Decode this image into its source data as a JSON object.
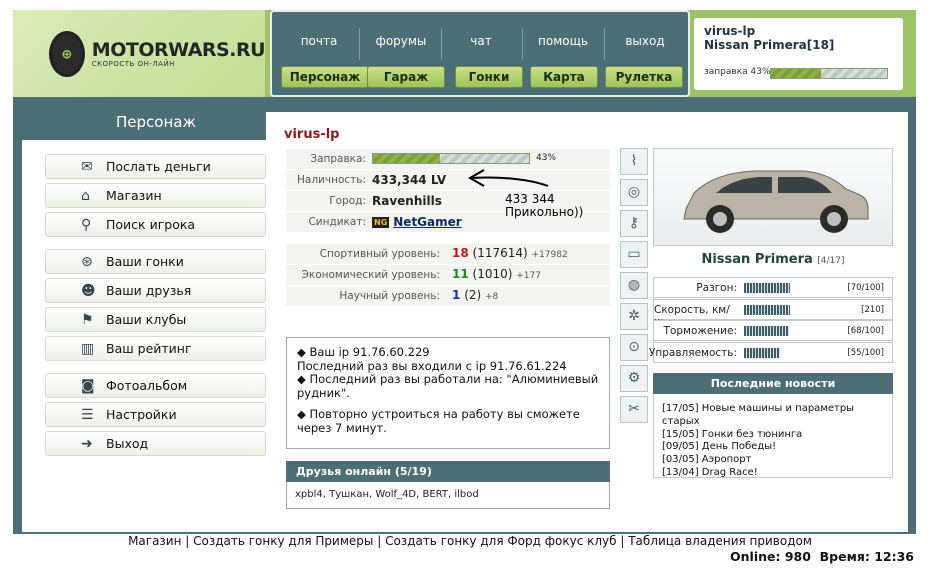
{
  "brand": {
    "name": "MOTORWARS.RU",
    "slogan": "СКОРОСТЬ ОН-ЛАЙН"
  },
  "topnav": {
    "links": [
      "почта",
      "форумы",
      "чат",
      "помощь",
      "выход"
    ],
    "buttons": [
      "Персонаж",
      "Гараж",
      "Гонки",
      "Карта",
      "Рулетка"
    ]
  },
  "user": {
    "name": "virus-lp",
    "car": "Nissan Primera[18]",
    "fuel_label": "заправка 43%",
    "fuel_fraction": 0.43
  },
  "section_title": "Персонаж",
  "menu": [
    {
      "label": "Послать деньги",
      "icon": "money-icon"
    },
    {
      "label": "Магазин",
      "icon": "shop-icon"
    },
    {
      "label": "Поиск игрока",
      "icon": "search-icon"
    },
    {
      "label": "Ваши гонки",
      "icon": "steering-wheel-icon"
    },
    {
      "label": "Ваши друзья",
      "icon": "friends-icon"
    },
    {
      "label": "Ваши клубы",
      "icon": "clubs-icon"
    },
    {
      "label": "Ваш рейтинг",
      "icon": "rating-icon"
    },
    {
      "label": "Фотоальбом",
      "icon": "camera-icon"
    },
    {
      "label": "Настройки",
      "icon": "settings-icon"
    },
    {
      "label": "Выход",
      "icon": "exit-icon"
    }
  ],
  "profile": {
    "name": "virus-lp",
    "fuel": {
      "label": "Заправка:",
      "value": "43%",
      "fraction": 0.43
    },
    "cash": {
      "label": "Наличность:",
      "value": "433,344 LV"
    },
    "city": {
      "label": "Город:",
      "value": "Ravenhills"
    },
    "syndicate": {
      "label": "Синдикат:",
      "badge": "NG",
      "value": "NetGamer"
    }
  },
  "annotation": {
    "line1": "433 344",
    "line2": "Прикольно))"
  },
  "levels": [
    {
      "label": "Спортивный уровень:",
      "level": "18",
      "points": "(117614)",
      "inc": "+17982",
      "color": "#c01818"
    },
    {
      "label": "Экономический уровень:",
      "level": "11",
      "points": "(1010)",
      "inc": "+177",
      "color": "#1a8a1a"
    },
    {
      "label": "Научный уровень:",
      "level": "1",
      "points": "(2)",
      "inc": "+8",
      "color": "#1a2aa0"
    }
  ],
  "messages": [
    "Ваш ip 91.76.60.229",
    "Последний раз вы входили с ip 91.76.61.224",
    "Последний раз вы работали на: \"Алюминиевый рудник\".",
    "Повторно устроиться на работу вы сможете через 7 минут."
  ],
  "friends": {
    "title": "Друзья онлайн (5/19)",
    "list": "xpbl4, Тушкан, Wolf_4D, BERT, ilbod"
  },
  "car": {
    "name": "Nissan Primera",
    "count": "[4/17]",
    "stats": [
      {
        "label": "Разгон:",
        "value": "[70/100]",
        "fraction": 0.7
      },
      {
        "label": "Скорость, км/ч:",
        "value": "[210]",
        "fraction": 0.0
      },
      {
        "label": "Торможение:",
        "value": "[68/100]",
        "fraction": 0.68
      },
      {
        "label": "Управляемость:",
        "value": "[55/100]",
        "fraction": 0.55
      }
    ]
  },
  "tuning_icons": [
    "shock-absorber-icon",
    "tire-icon",
    "spark-plug-icon",
    "exhaust-icon",
    "brake-disc-icon",
    "wheel-rim-icon",
    "turbo-icon",
    "engine-icon",
    "tools-icon"
  ],
  "news": {
    "title": "Последние новости",
    "items": [
      "[17/05] Новые машины и параметры старых",
      "[15/05] Гонки без тюнинга",
      "[09/05] День Победы!",
      "[03/05] Аэропорт",
      "[13/04] Drag Race!"
    ]
  },
  "footer": {
    "links": [
      "Магазин",
      "Создать гонку для Примеры",
      "Создать гонку для Форд фокус клуб",
      "Таблица владения приводом"
    ],
    "online": "Online: 980",
    "time": "Время: 12:36"
  }
}
